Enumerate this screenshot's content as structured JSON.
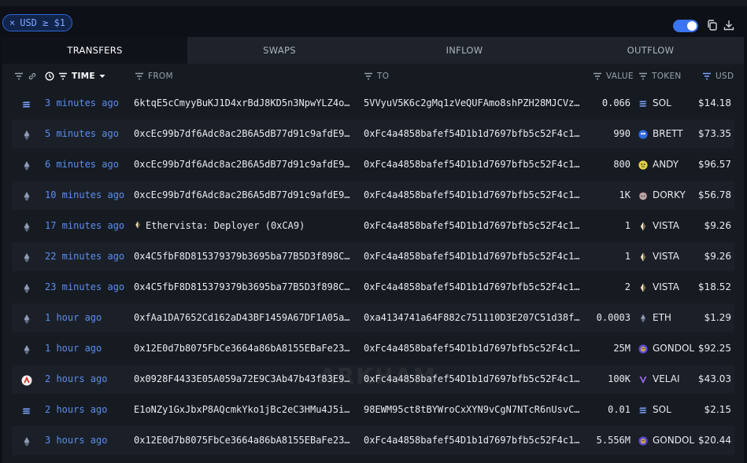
{
  "filter": {
    "label": "USD ≥ $1"
  },
  "tabs": [
    "TRANSFERS",
    "SWAPS",
    "INFLOW",
    "OUTFLOW"
  ],
  "columns": {
    "time": "TIME",
    "from": "FROM",
    "to": "TO",
    "value": "VALUE",
    "token": "TOKEN",
    "usd": "USD"
  },
  "watermark": "ARKHAM",
  "rows": [
    {
      "chain": "solana",
      "time": "3 minutes ago",
      "from": "6ktqE5cCmyyBuKJ1D4xrBdJ8KD5n3NpwYLZ4o…",
      "to": "5VVyuV5K6c2gMq1zVeQUFAmo8shPZH28MJCVz…",
      "value": "0.066",
      "token": "SOL",
      "token_icon": "solana-icon",
      "usd": "$14.18"
    },
    {
      "chain": "ethereum",
      "time": "5 minutes ago",
      "from": "0xcEc99b7df6Adc8ac2B6A5dB77d91c9afdE9…",
      "to": "0xFc4a4858bafef54D1b1d7697bfb5c52F4c1…",
      "value": "990",
      "token": "BRETT",
      "token_icon": "brett-icon",
      "usd": "$73.35"
    },
    {
      "chain": "ethereum",
      "time": "6 minutes ago",
      "from": "0xcEc99b7df6Adc8ac2B6A5dB77d91c9afdE9…",
      "to": "0xFc4a4858bafef54D1b1d7697bfb5c52F4c1…",
      "value": "800",
      "token": "ANDY",
      "token_icon": "andy-icon",
      "usd": "$96.57"
    },
    {
      "chain": "ethereum",
      "time": "10 minutes ago",
      "from": "0xcEc99b7df6Adc8ac2B6A5dB77d91c9afdE9…",
      "to": "0xFc4a4858bafef54D1b1d7697bfb5c52F4c1…",
      "value": "1K",
      "token": "DORKY",
      "token_icon": "dorky-icon",
      "usd": "$56.78"
    },
    {
      "chain": "ethereum",
      "time": "17 minutes ago",
      "from": "Ethervista: Deployer (0xCA9)",
      "from_entity": true,
      "to": "0xFc4a4858bafef54D1b1d7697bfb5c52F4c1…",
      "value": "1",
      "token": "VISTA",
      "token_icon": "vista-icon",
      "usd": "$9.26"
    },
    {
      "chain": "ethereum",
      "time": "22 minutes ago",
      "from": "0x4C5fbF8D815379379b3695ba77B5D3f898C…",
      "to": "0xFc4a4858bafef54D1b1d7697bfb5c52F4c1…",
      "value": "1",
      "token": "VISTA",
      "token_icon": "vista-icon",
      "usd": "$9.26"
    },
    {
      "chain": "ethereum",
      "time": "23 minutes ago",
      "from": "0x4C5fbF8D815379379b3695ba77B5D3f898C…",
      "to": "0xFc4a4858bafef54D1b1d7697bfb5c52F4c1…",
      "value": "2",
      "token": "VISTA",
      "token_icon": "vista-icon",
      "usd": "$18.52"
    },
    {
      "chain": "ethereum",
      "time": "1 hour ago",
      "from": "0xfAa1DA7652Cd162aD43BF1459A67DF1A05a…",
      "to": "0xa4134741a64F882c751110D3E207C51d38f…",
      "value": "0.0003",
      "token": "ETH",
      "token_icon": "eth-icon",
      "usd": "$1.29"
    },
    {
      "chain": "ethereum",
      "time": "1 hour ago",
      "from": "0x12E0d7b8075FbCe3664a86bA8155EBaFe23…",
      "to": "0xFc4a4858bafef54D1b1d7697bfb5c52F4c1…",
      "value": "25M",
      "token": "GONDOL",
      "token_icon": "gondol-icon",
      "usd": "$92.25"
    },
    {
      "chain": "arbitrum",
      "time": "2 hours ago",
      "from": "0x0928F4433E05A059a72E9C3Ab47b43f83E9…",
      "to": "0xFc4a4858bafef54D1b1d7697bfb5c52F4c1…",
      "value": "100K",
      "token": "VELAI",
      "token_icon": "velai-icon",
      "usd": "$43.03"
    },
    {
      "chain": "solana",
      "time": "2 hours ago",
      "from": "E1oNZy1GxJbxP8AQcmkYko1jBc2eC3HMu4J5i…",
      "to": "98EWM95ct8tBYWroCxXYN9vCgN7NTcR6nUsvC…",
      "value": "0.01",
      "token": "SOL",
      "token_icon": "solana-icon",
      "usd": "$2.15"
    },
    {
      "chain": "ethereum",
      "time": "3 hours ago",
      "from": "0x12E0d7b8075FbCe3664a86bA8155EBaFe23…",
      "to": "0xFc4a4858bafef54D1b1d7697bfb5c52F4c1…",
      "value": "5.556M",
      "token": "GONDOL",
      "token_icon": "gondol-icon",
      "usd": "$20.44"
    }
  ]
}
